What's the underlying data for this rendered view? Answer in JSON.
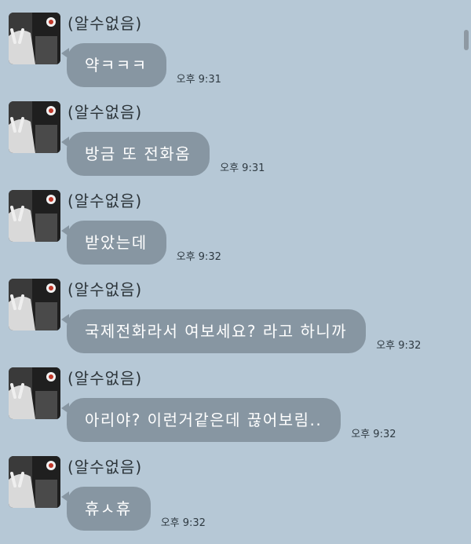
{
  "messages": [
    {
      "sender": "(알수없음)",
      "text": "약ㅋㅋㅋ",
      "time": "오후 9:31"
    },
    {
      "sender": "(알수없음)",
      "text": "방금 또 전화옴",
      "time": "오후 9:31"
    },
    {
      "sender": "(알수없음)",
      "text": "받았는데",
      "time": "오후 9:32"
    },
    {
      "sender": "(알수없음)",
      "text": "국제전화라서 여보세요? 라고 하니까",
      "time": "오후 9:32"
    },
    {
      "sender": "(알수없음)",
      "text": "아리야? 이런거같은데 끊어보림..",
      "time": "오후 9:32"
    },
    {
      "sender": "(알수없음)",
      "text": "휴ㅅ휴",
      "time": "오후 9:32"
    }
  ],
  "colors": {
    "background": "#b6c8d6",
    "bubble": "#8796a2",
    "bubble_text": "#ffffff"
  }
}
